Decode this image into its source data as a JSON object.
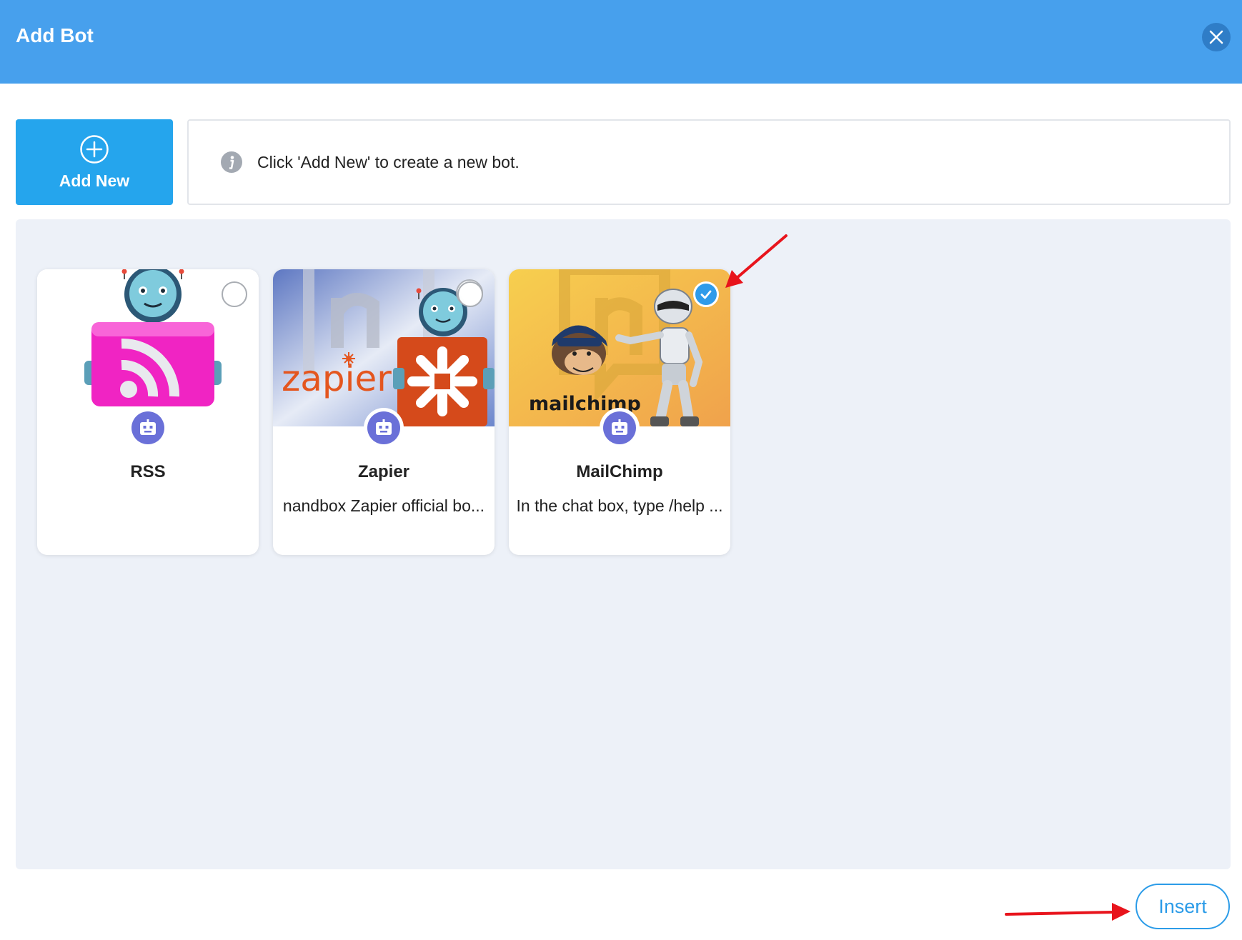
{
  "dialog": {
    "title": "Add Bot",
    "close_icon": "close-icon",
    "header_color": "#47a0ed"
  },
  "toolbar": {
    "add_new_label": "Add New",
    "add_new_icon": "plus-circle-icon",
    "info_icon": "info-icon",
    "info_text": "Click 'Add New' to create a new bot."
  },
  "bots": [
    {
      "name": "RSS",
      "description": "",
      "selected": false,
      "image_icon": "rss-robot-image",
      "avatar_icon": "robot-icon"
    },
    {
      "name": "Zapier",
      "description": "nandbox Zapier official bo...",
      "selected": false,
      "image_icon": "zapier-robot-image",
      "avatar_icon": "robot-icon"
    },
    {
      "name": "MailChimp",
      "description": "In the chat box, type /help ...",
      "selected": true,
      "image_icon": "mailchimp-robot-image",
      "avatar_icon": "robot-icon",
      "image_logo_text": "mailchimp"
    }
  ],
  "footer": {
    "insert_label": "Insert"
  },
  "colors": {
    "accent": "#25a5ed",
    "selected": "#2f9bea",
    "panel_bg": "#edf1f8",
    "annotation_arrow": "#e8141c"
  }
}
